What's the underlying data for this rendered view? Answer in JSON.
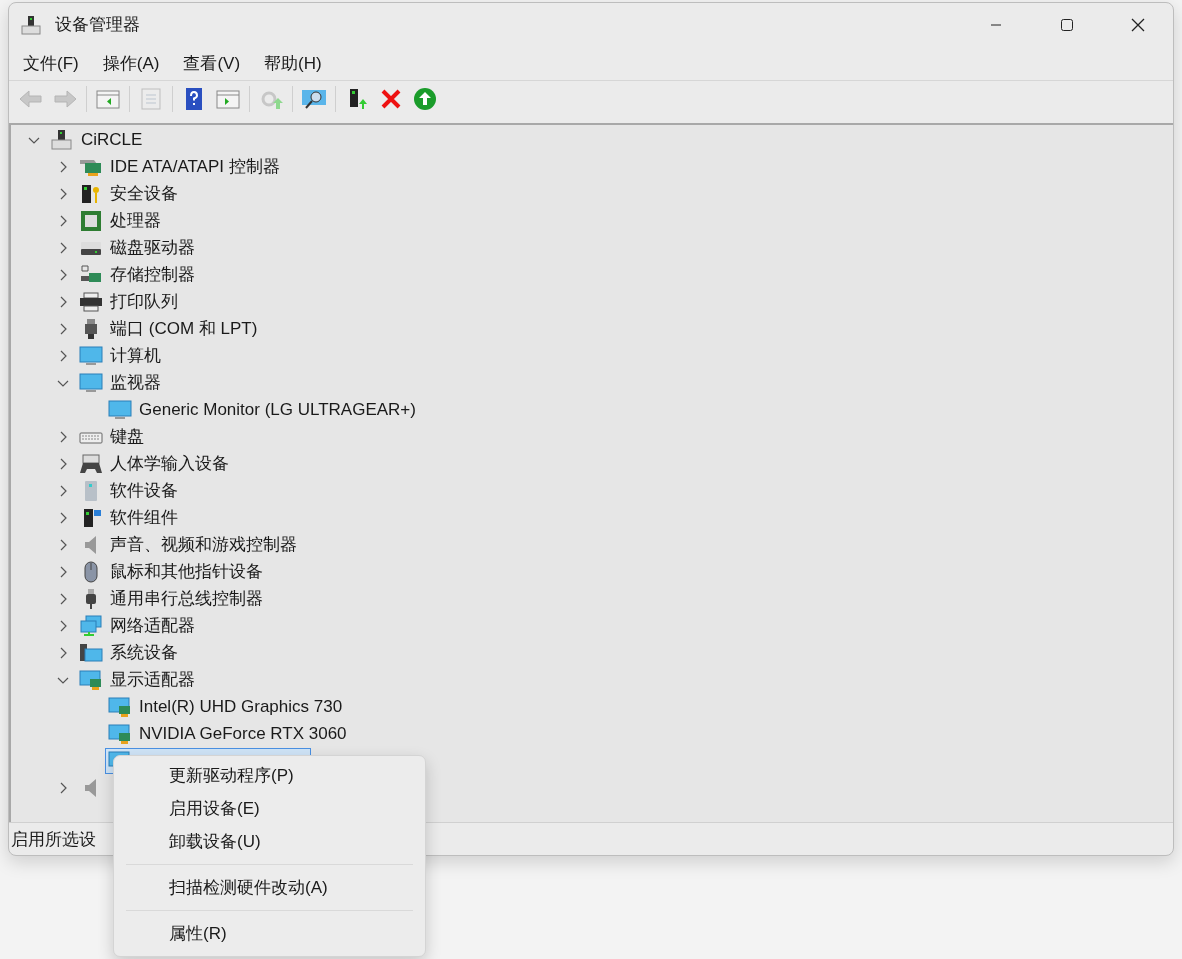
{
  "window": {
    "title": "设备管理器"
  },
  "menu_bar": [
    {
      "label": "文件(F)"
    },
    {
      "label": "操作(A)"
    },
    {
      "label": "查看(V)"
    },
    {
      "label": "帮助(H)"
    }
  ],
  "toolbar": [
    {
      "kind": "back",
      "disabled": true
    },
    {
      "kind": "forward",
      "disabled": true
    },
    {
      "kind": "sep"
    },
    {
      "kind": "tree-view",
      "disabled": false
    },
    {
      "kind": "sep"
    },
    {
      "kind": "properties",
      "disabled": true
    },
    {
      "kind": "sep"
    },
    {
      "kind": "help",
      "disabled": false
    },
    {
      "kind": "action-pane",
      "disabled": false
    },
    {
      "kind": "sep"
    },
    {
      "kind": "update-driver",
      "disabled": true
    },
    {
      "kind": "sep"
    },
    {
      "kind": "scan",
      "disabled": false
    },
    {
      "kind": "sep"
    },
    {
      "kind": "enable",
      "disabled": false
    },
    {
      "kind": "remove",
      "disabled": false
    },
    {
      "kind": "upgrade",
      "disabled": false
    }
  ],
  "tree": {
    "label": "CiRCLE",
    "kind": "computer-root",
    "expanded": true,
    "selected": false,
    "children": [
      {
        "label": "IDE ATA/ATAPI 控制器",
        "kind": "card",
        "expanded": false,
        "selected": false
      },
      {
        "label": "安全设备",
        "kind": "security",
        "expanded": false,
        "selected": false
      },
      {
        "label": "处理器",
        "kind": "chip",
        "expanded": false,
        "selected": false
      },
      {
        "label": "磁盘驱动器",
        "kind": "drive",
        "expanded": false,
        "selected": false
      },
      {
        "label": "存储控制器",
        "kind": "storage",
        "expanded": false,
        "selected": false
      },
      {
        "label": "打印队列",
        "kind": "printer",
        "expanded": false,
        "selected": false
      },
      {
        "label": "端口 (COM 和 LPT)",
        "kind": "port",
        "expanded": false,
        "selected": false
      },
      {
        "label": "计算机",
        "kind": "monitor",
        "expanded": false,
        "selected": false
      },
      {
        "label": "监视器",
        "kind": "monitor",
        "expanded": true,
        "selected": false,
        "children": [
          {
            "label": "Generic Monitor (LG ULTRAGEAR+)",
            "kind": "monitor",
            "selected": false
          }
        ]
      },
      {
        "label": "键盘",
        "kind": "keyboard",
        "expanded": false,
        "selected": false
      },
      {
        "label": "人体学输入设备",
        "kind": "hid",
        "expanded": false,
        "selected": false
      },
      {
        "label": "软件设备",
        "kind": "software",
        "expanded": false,
        "selected": false
      },
      {
        "label": "软件组件",
        "kind": "component",
        "expanded": false,
        "selected": false
      },
      {
        "label": "声音、视频和游戏控制器",
        "kind": "speaker",
        "expanded": false,
        "selected": false
      },
      {
        "label": "鼠标和其他指针设备",
        "kind": "mouse",
        "expanded": false,
        "selected": false
      },
      {
        "label": "通用串行总线控制器",
        "kind": "usb",
        "expanded": false,
        "selected": false
      },
      {
        "label": "网络适配器",
        "kind": "network",
        "expanded": false,
        "selected": false
      },
      {
        "label": "系统设备",
        "kind": "system",
        "expanded": false,
        "selected": false
      },
      {
        "label": "显示适配器",
        "kind": "display",
        "expanded": true,
        "selected": false,
        "children": [
          {
            "label": "Intel(R) UHD Graphics 730",
            "kind": "display",
            "selected": false
          },
          {
            "label": "NVIDIA GeForce RTX 3060",
            "kind": "display",
            "selected": false
          },
          {
            "kind": "display",
            "selected": true
          }
        ]
      },
      {
        "kind": "speaker",
        "expanded": false,
        "selected": false
      }
    ]
  },
  "status_bar": {
    "text": "启用所选设"
  },
  "context_menu": [
    {
      "kind": "item",
      "label": "更新驱动程序(P)"
    },
    {
      "kind": "item",
      "label": "启用设备(E)"
    },
    {
      "kind": "item",
      "label": "卸载设备(U)"
    },
    {
      "kind": "separator"
    },
    {
      "kind": "item",
      "label": "扫描检测硬件改动(A)"
    },
    {
      "kind": "separator"
    },
    {
      "kind": "item",
      "label": "属性(R)"
    }
  ]
}
